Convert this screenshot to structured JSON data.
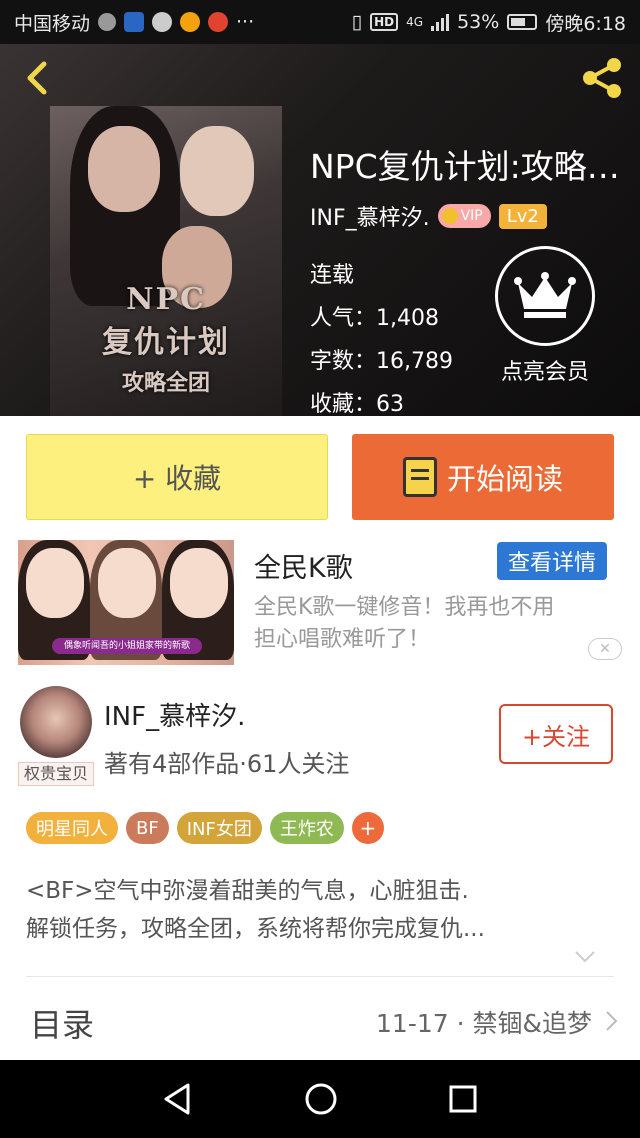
{
  "status_bar": {
    "carrier": "中国移动",
    "more": "···",
    "network_badge": "HD",
    "network_type": "4G",
    "battery": "53%",
    "time": "傍晚6:18"
  },
  "header": {
    "back_icon": "chevron-left-icon",
    "share_icon": "share-icon",
    "cover_text": {
      "line1": "NPC",
      "line2": "复仇计划",
      "line3": "攻略全团"
    },
    "title": "NPC复仇计划:攻略全团",
    "author": "INF_慕梓汐.",
    "vip_label": "VIP",
    "level": "Lv2",
    "status": "连载",
    "popularity_label": "人气：",
    "popularity": "1,408",
    "words_label": "字数：",
    "words": "16,789",
    "favorites_label": "收藏：",
    "favorites": "63",
    "member_label": "点亮会员"
  },
  "actions": {
    "collect_label": "+ 收藏",
    "read_label": "开始阅读"
  },
  "ad": {
    "banner_text": "偶象听闻吾的小姐姐家带的新歌",
    "title": "全民K歌",
    "detail_button": "查看详情",
    "description_line1": "全民K歌一键修音！我再也不用",
    "description_line2": "担心唱歌难听了！",
    "close_label": "✕"
  },
  "author_card": {
    "name": "INF_慕梓汐.",
    "badge": "权贵宝贝",
    "stats": "著有4部作品·61人关注",
    "follow_label": "+关注"
  },
  "tags": [
    "明星同人",
    "BF",
    "INF女团",
    "王炸农"
  ],
  "tag_more": "+",
  "synopsis": {
    "line1": "<BF>空气中弥漫着甜美的气息，心脏狙击.",
    "line2": "解锁任务，攻略全团，系统将帮你完成复仇..."
  },
  "toc": {
    "label": "目录",
    "latest": "11-17 · 禁锢&追梦"
  },
  "colors": {
    "accent_orange": "#ec6a36",
    "collect_yellow": "#fdf07e",
    "follow_red": "#d9472f",
    "ad_blue": "#2d78d5"
  }
}
